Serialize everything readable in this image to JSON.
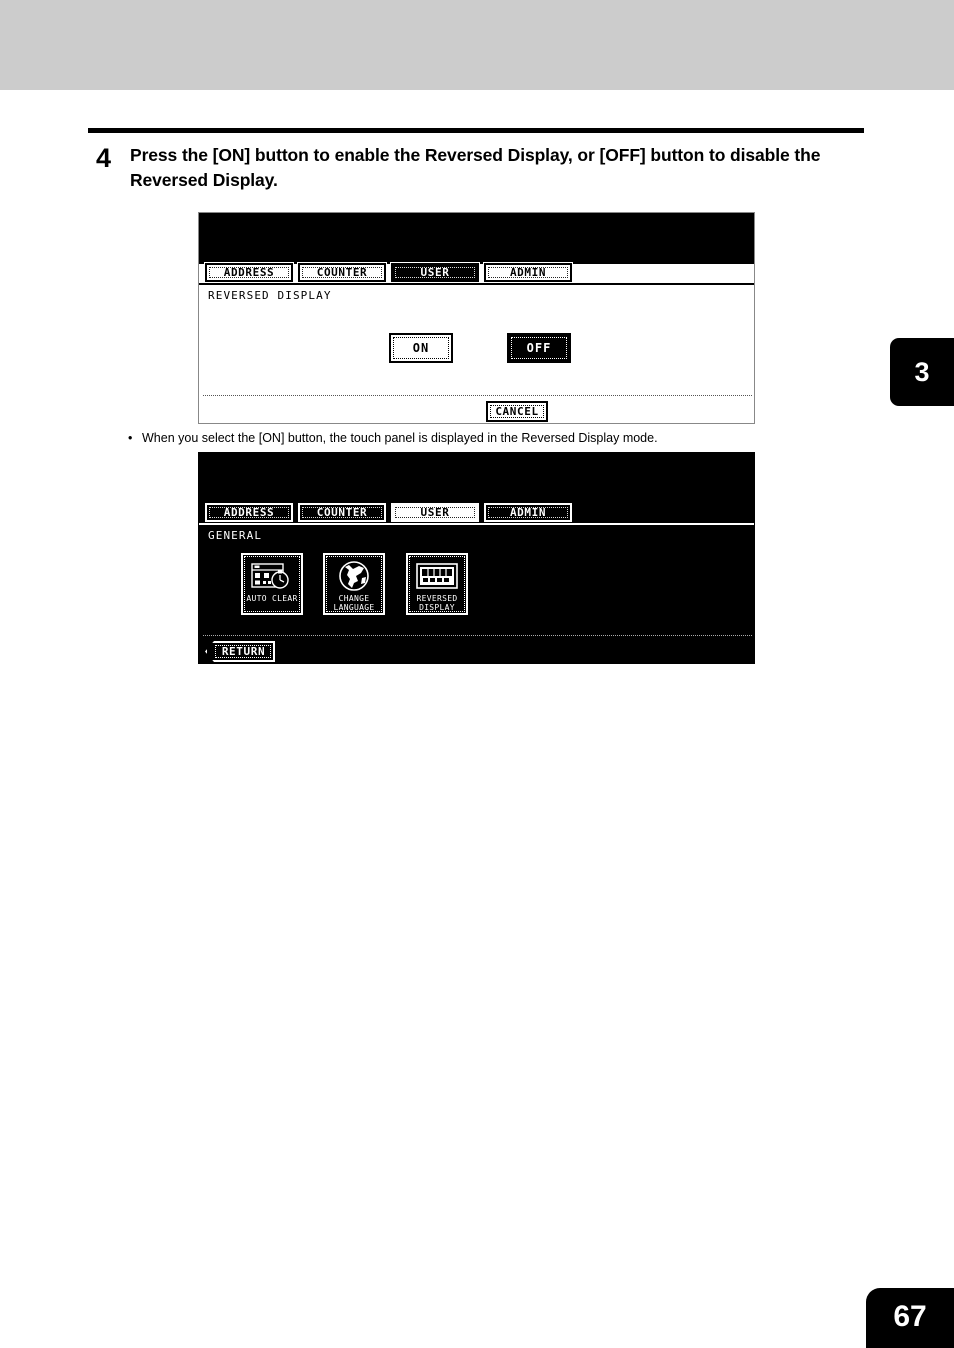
{
  "page": {
    "number": "67",
    "chapter_tab": "3"
  },
  "step": {
    "number": "4",
    "text": "Press the [ON] button to enable the Reversed Display, or [OFF] button to disable the Reversed Display."
  },
  "note": {
    "bullet": "•",
    "text": "When you select the [ON] button, the touch panel is displayed in the Reversed Display mode."
  },
  "panel_normal": {
    "tabs": [
      {
        "label": "ADDRESS",
        "selected": false
      },
      {
        "label": "COUNTER",
        "selected": false
      },
      {
        "label": "USER",
        "selected": true
      },
      {
        "label": "ADMIN",
        "selected": false
      }
    ],
    "screen_title": "REVERSED DISPLAY",
    "toggles": [
      {
        "label": "ON",
        "selected": false
      },
      {
        "label": "OFF",
        "selected": true
      }
    ],
    "cancel_label": "CANCEL"
  },
  "panel_reversed": {
    "tabs": [
      {
        "label": "ADDRESS",
        "selected": false
      },
      {
        "label": "COUNTER",
        "selected": false
      },
      {
        "label": "USER",
        "selected": true
      },
      {
        "label": "ADMIN",
        "selected": false
      }
    ],
    "screen_title": "GENERAL",
    "icons": [
      {
        "label": "AUTO CLEAR",
        "icon": "auto-clear-icon"
      },
      {
        "label": "CHANGE\nLANGUAGE",
        "icon": "change-language-icon"
      },
      {
        "label": "REVERSED\nDISPLAY",
        "icon": "reversed-display-icon"
      }
    ],
    "return_label": "RETURN"
  },
  "colors": {
    "top_band": "#cccccc",
    "ink": "#000000",
    "paper": "#ffffff"
  }
}
